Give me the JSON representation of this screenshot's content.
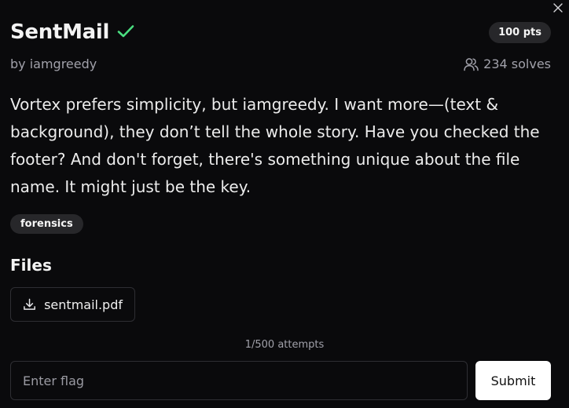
{
  "challenge": {
    "title": "SentMail",
    "points": "100 pts",
    "author": "by iamgreedy",
    "solves": "234 solves",
    "description": "Vortex prefers simplicity, but iamgreedy. I want more—(text & background), they don’t tell the whole story. Have you checked the footer? And don't forget, there's something unique about the file name. It might just be the key.",
    "tag": "forensics"
  },
  "files": {
    "heading": "Files",
    "items": [
      {
        "name": "sentmail.pdf",
        "icon": "download-icon"
      }
    ]
  },
  "submission": {
    "attempts": "1/500 attempts",
    "placeholder": "Enter flag",
    "value": "",
    "submit_label": "Submit"
  },
  "icons": {
    "close": "close-icon",
    "solved": "check-icon",
    "solves": "users-icon"
  },
  "colors": {
    "background": "#0a0a0c",
    "check": "#4ade80",
    "badge_bg": "#27272a",
    "muted": "#a1a1aa",
    "submit_bg": "#ffffff"
  }
}
